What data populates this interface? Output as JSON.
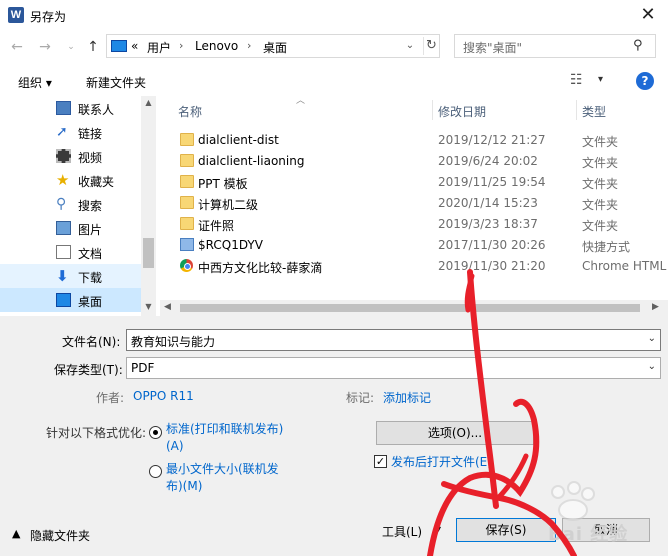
{
  "window": {
    "title": "另存为",
    "app_icon": "W"
  },
  "nav": {
    "breadcrumb": [
      "«",
      "用户",
      "Lenovo",
      "桌面"
    ],
    "search_placeholder": "搜索\"桌面\""
  },
  "toolbar": {
    "organize": "组织",
    "new_folder": "新建文件夹",
    "help": "?"
  },
  "sidebar": {
    "items": [
      {
        "label": "联系人",
        "icon": "contacts-icon"
      },
      {
        "label": "链接",
        "icon": "link-icon"
      },
      {
        "label": "视频",
        "icon": "video-icon"
      },
      {
        "label": "收藏夹",
        "icon": "star-icon"
      },
      {
        "label": "搜索",
        "icon": "search-icon"
      },
      {
        "label": "图片",
        "icon": "picture-icon"
      },
      {
        "label": "文档",
        "icon": "document-icon"
      },
      {
        "label": "下载",
        "icon": "download-icon"
      },
      {
        "label": "桌面",
        "icon": "desktop-icon"
      }
    ]
  },
  "filelist": {
    "columns": {
      "name": "名称",
      "date": "修改日期",
      "type": "类型"
    },
    "rows": [
      {
        "name": "dialclient-dist",
        "date": "2019/12/12 21:27",
        "type": "文件夹",
        "icon": "folder-icon"
      },
      {
        "name": "dialclient-liaoning",
        "date": "2019/6/24 20:02",
        "type": "文件夹",
        "icon": "folder-icon"
      },
      {
        "name": "PPT 模板",
        "date": "2019/11/25 19:54",
        "type": "文件夹",
        "icon": "folder-icon"
      },
      {
        "name": "计算机二级",
        "date": "2020/1/14 15:23",
        "type": "文件夹",
        "icon": "folder-icon"
      },
      {
        "name": "证件照",
        "date": "2019/3/23 18:37",
        "type": "文件夹",
        "icon": "folder-icon"
      },
      {
        "name": "$RCQ1DYV",
        "date": "2017/11/30 20:26",
        "type": "快捷方式",
        "icon": "shortcut-icon"
      },
      {
        "name": "中西方文化比较-薛家滴",
        "date": "2019/11/30 21:20",
        "type": "Chrome HTML",
        "icon": "chrome-icon"
      }
    ]
  },
  "form": {
    "filename_label": "文件名(N):",
    "filename_value": "教育知识与能力",
    "filetype_label": "保存类型(T):",
    "filetype_value": "PDF",
    "author_label": "作者:",
    "author_value": "OPPO R11",
    "tags_label": "标记:",
    "tags_value": "添加标记",
    "optimize_label": "针对以下格式优化:",
    "opt_standard_line1": "标准(打印和联机发布)",
    "opt_standard_line2": "(A)",
    "opt_min_line1": "最小文件大小(联机发",
    "opt_min_line2": "布)(M)",
    "options_button": "选项(O)...",
    "open_after_publish": "发布后打开文件(E)"
  },
  "footer": {
    "hide_folders": "隐藏文件夹",
    "tools": "工具(L)",
    "save": "保存(S)",
    "cancel": "取消"
  },
  "watermark": {
    "text": "Bai 经验"
  },
  "colors": {
    "selection": "#cce8ff",
    "link": "#0066cc",
    "annotation": "#e8202a"
  }
}
